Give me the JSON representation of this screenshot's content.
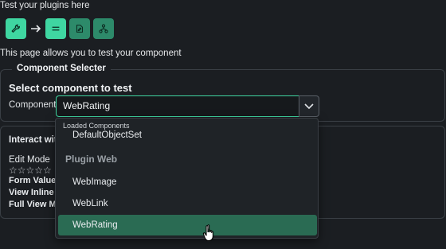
{
  "header": {
    "title": "Test your plugins here"
  },
  "toolbar": {
    "buttons": [
      {
        "name": "wrench-icon",
        "state": "active"
      },
      {
        "name": "equals-icon",
        "state": "active"
      },
      {
        "name": "edit-icon",
        "state": "inactive"
      },
      {
        "name": "network-icon",
        "state": "inactive"
      }
    ],
    "accent": "#3fd6a1",
    "accent_dim": "#2d8a6a"
  },
  "intro": {
    "text": "This page allows you to test your component"
  },
  "component_selector": {
    "legend": "Component Selecter",
    "heading": "Select component to test",
    "label": "Component",
    "value": "WebRating"
  },
  "interact": {
    "heading": "Interact with",
    "edit_mode": "Edit Mode",
    "stars": "☆☆☆☆☆",
    "form_value": "Form Value is",
    "view_inline": "View Inline M",
    "full_view": "Full View Mo"
  },
  "dropdown": {
    "group_loaded": "Loaded Components",
    "items_loaded": [
      "DefaultObjectSet"
    ],
    "group_web": "Plugin Web",
    "items_web": [
      "WebImage",
      "WebLink",
      "WebRating"
    ],
    "selected": "WebRating"
  }
}
